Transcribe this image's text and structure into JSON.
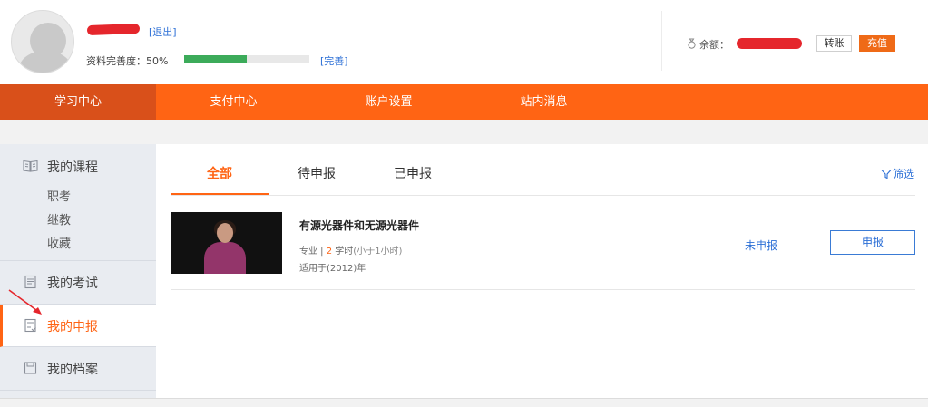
{
  "header": {
    "logout": "[退出]",
    "profile_label": "资料完善度：50%",
    "profile_progress": 0.5,
    "complete_link": "[完善]",
    "balance_label": "余额：",
    "transfer": "转账",
    "recharge": "充值"
  },
  "nav": {
    "items": [
      "学习中心",
      "支付中心",
      "账户设置",
      "站内消息"
    ],
    "active_index": 0
  },
  "sidebar": {
    "courses": {
      "title": "我的课程",
      "subs": [
        "职考",
        "继教",
        "收藏"
      ]
    },
    "exams": {
      "title": "我的考试"
    },
    "declare": {
      "title": "我的申报"
    },
    "archive": {
      "title": "我的档案"
    }
  },
  "tabs": {
    "all": "全部",
    "pending": "待申报",
    "declared": "已申报",
    "filter": "筛选"
  },
  "course": {
    "title": "有源光器件和无源光器件",
    "category": "专业",
    "separator": " | ",
    "hours": "2",
    "hours_unit": " 学时",
    "hours_note": "(小于1小时)",
    "applies": "适用于(2012)年",
    "status": "未申报",
    "action": "申报"
  },
  "colors": {
    "accent": "#ff6414",
    "link": "#2c6fd6",
    "progress": "#3cab5a"
  }
}
